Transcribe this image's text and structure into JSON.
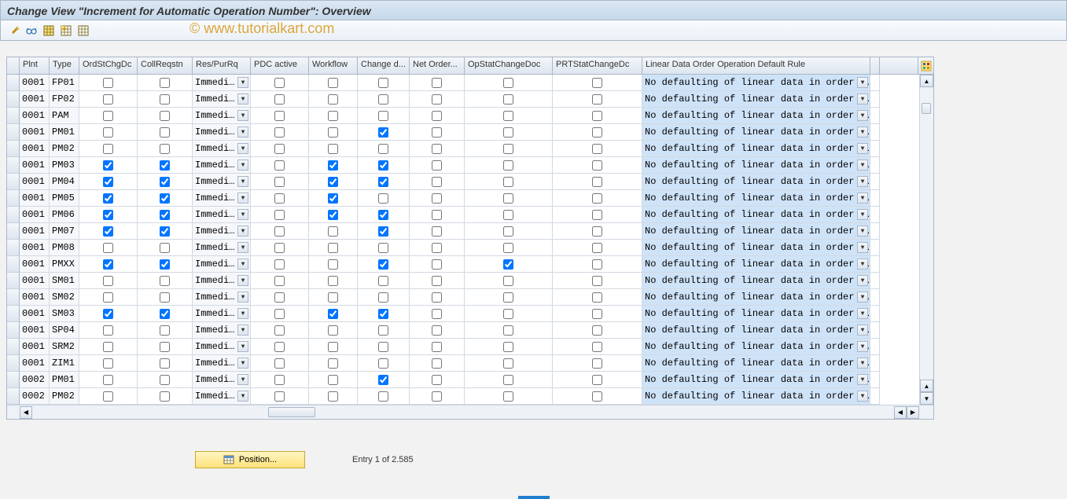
{
  "title": "Change View \"Increment for Automatic Operation Number\": Overview",
  "watermark_prefix": "© ",
  "watermark": "www.tutorialkart.com",
  "toolbar": {
    "icons": [
      "wrench-icon",
      "glasses-icon",
      "table-icon-1",
      "table-icon-2",
      "table-icon-3"
    ]
  },
  "columns": {
    "plnt": "Plnt",
    "type": "Type",
    "ordst": "OrdStChgDc",
    "collreq": "CollReqstn",
    "respur": "Res/PurRq",
    "pdc": "PDC active",
    "workflow": "Workflow",
    "changed": "Change d...",
    "netorder": "Net Order...",
    "opstat": "OpStatChangeDoc",
    "prtstat": "PRTStatChangeDc",
    "linear": "Linear Data Order Operation Default Rule"
  },
  "dropdown_value": "Immedi…",
  "linear_value": "No defaulting of linear data in order o…",
  "rows": [
    {
      "plnt": "0001",
      "type": "FP01",
      "ordst": false,
      "collreq": false,
      "pdc": false,
      "workflow": false,
      "changed": false,
      "netorder": false,
      "opstat": false,
      "prtstat": false,
      "sel": true
    },
    {
      "plnt": "0001",
      "type": "FP02",
      "ordst": false,
      "collreq": false,
      "pdc": false,
      "workflow": false,
      "changed": false,
      "netorder": false,
      "opstat": false,
      "prtstat": false,
      "sel": false
    },
    {
      "plnt": "0001",
      "type": "PAM",
      "ordst": false,
      "collreq": false,
      "pdc": false,
      "workflow": false,
      "changed": false,
      "netorder": false,
      "opstat": false,
      "prtstat": false,
      "sel": false
    },
    {
      "plnt": "0001",
      "type": "PM01",
      "ordst": false,
      "collreq": false,
      "pdc": false,
      "workflow": false,
      "changed": true,
      "netorder": false,
      "opstat": false,
      "prtstat": false,
      "sel": false
    },
    {
      "plnt": "0001",
      "type": "PM02",
      "ordst": false,
      "collreq": false,
      "pdc": false,
      "workflow": false,
      "changed": false,
      "netorder": false,
      "opstat": false,
      "prtstat": false,
      "sel": false
    },
    {
      "plnt": "0001",
      "type": "PM03",
      "ordst": true,
      "collreq": true,
      "pdc": false,
      "workflow": true,
      "changed": true,
      "netorder": false,
      "opstat": false,
      "prtstat": false,
      "sel": false
    },
    {
      "plnt": "0001",
      "type": "PM04",
      "ordst": true,
      "collreq": true,
      "pdc": false,
      "workflow": true,
      "changed": true,
      "netorder": false,
      "opstat": false,
      "prtstat": false,
      "sel": false
    },
    {
      "plnt": "0001",
      "type": "PM05",
      "ordst": true,
      "collreq": true,
      "pdc": false,
      "workflow": true,
      "changed": false,
      "netorder": false,
      "opstat": false,
      "prtstat": false,
      "sel": false
    },
    {
      "plnt": "0001",
      "type": "PM06",
      "ordst": true,
      "collreq": true,
      "pdc": false,
      "workflow": true,
      "changed": true,
      "netorder": false,
      "opstat": false,
      "prtstat": false,
      "sel": false
    },
    {
      "plnt": "0001",
      "type": "PM07",
      "ordst": true,
      "collreq": true,
      "pdc": false,
      "workflow": false,
      "changed": true,
      "netorder": false,
      "opstat": false,
      "prtstat": false,
      "sel": false
    },
    {
      "plnt": "0001",
      "type": "PM08",
      "ordst": false,
      "collreq": false,
      "pdc": false,
      "workflow": false,
      "changed": false,
      "netorder": false,
      "opstat": false,
      "prtstat": false,
      "sel": false
    },
    {
      "plnt": "0001",
      "type": "PMXX",
      "ordst": true,
      "collreq": true,
      "pdc": false,
      "workflow": false,
      "changed": true,
      "netorder": false,
      "opstat": true,
      "prtstat": false,
      "sel": false
    },
    {
      "plnt": "0001",
      "type": "SM01",
      "ordst": false,
      "collreq": false,
      "pdc": false,
      "workflow": false,
      "changed": false,
      "netorder": false,
      "opstat": false,
      "prtstat": false,
      "sel": false
    },
    {
      "plnt": "0001",
      "type": "SM02",
      "ordst": false,
      "collreq": false,
      "pdc": false,
      "workflow": false,
      "changed": false,
      "netorder": false,
      "opstat": false,
      "prtstat": false,
      "sel": false
    },
    {
      "plnt": "0001",
      "type": "SM03",
      "ordst": true,
      "collreq": true,
      "pdc": false,
      "workflow": true,
      "changed": true,
      "netorder": false,
      "opstat": false,
      "prtstat": false,
      "sel": false
    },
    {
      "plnt": "0001",
      "type": "SP04",
      "ordst": false,
      "collreq": false,
      "pdc": false,
      "workflow": false,
      "changed": false,
      "netorder": false,
      "opstat": false,
      "prtstat": false,
      "sel": false
    },
    {
      "plnt": "0001",
      "type": "SRM2",
      "ordst": false,
      "collreq": false,
      "pdc": false,
      "workflow": false,
      "changed": false,
      "netorder": false,
      "opstat": false,
      "prtstat": false,
      "sel": false
    },
    {
      "plnt": "0001",
      "type": "ZIM1",
      "ordst": false,
      "collreq": false,
      "pdc": false,
      "workflow": false,
      "changed": false,
      "netorder": false,
      "opstat": false,
      "prtstat": false,
      "sel": false
    },
    {
      "plnt": "0002",
      "type": "PM01",
      "ordst": false,
      "collreq": false,
      "pdc": false,
      "workflow": false,
      "changed": true,
      "netorder": false,
      "opstat": false,
      "prtstat": false,
      "sel": false
    },
    {
      "plnt": "0002",
      "type": "PM02",
      "ordst": false,
      "collreq": false,
      "pdc": false,
      "workflow": false,
      "changed": false,
      "netorder": false,
      "opstat": false,
      "prtstat": false,
      "sel": false
    }
  ],
  "footer": {
    "position_label": "Position...",
    "entry_text": "Entry 1 of 2.585"
  }
}
